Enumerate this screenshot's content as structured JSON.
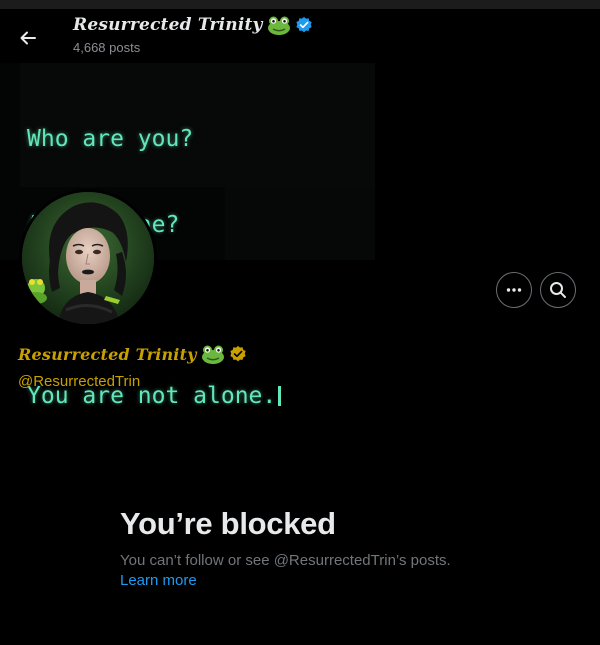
{
  "header": {
    "back_icon": "arrow-left-icon",
    "display_name": "Resurrected Trinity",
    "posts_count": "4,668 posts",
    "verified_icon": "verified-badge-icon",
    "verified_color": "#1d9bf0"
  },
  "banner": {
    "lines": [
      "Who are you?",
      "Am I alone?",
      "",
      "You are not alone."
    ],
    "text_color": "#62e8b8"
  },
  "profile": {
    "display_name": "Resurrected Trinity",
    "handle": "@ResurrectedTrin",
    "name_color": "#c8a000",
    "verified_icon": "gold-verified-badge-icon",
    "verified_color": "#c8a000",
    "avatar_icon": "profile-avatar"
  },
  "actions": {
    "more_icon": "more-dots-icon",
    "search_icon": "search-icon"
  },
  "blocked": {
    "title": "You’re blocked",
    "description": "You can’t follow or see @ResurrectedTrin’s posts.",
    "learn_more": "Learn more",
    "link_color": "#1d9bf0"
  }
}
